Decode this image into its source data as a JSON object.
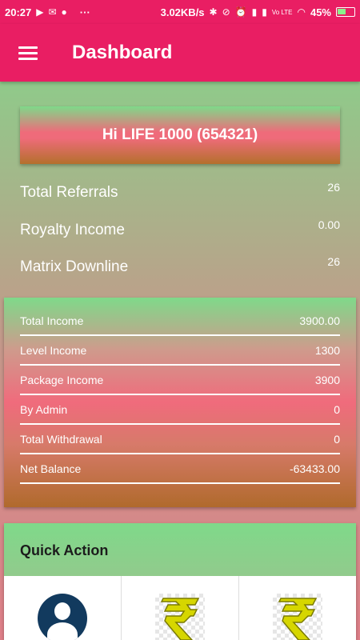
{
  "status_bar": {
    "time": "20:27",
    "dots": "···",
    "speed": "3.02KB/s",
    "battery": "45%",
    "network": "Vo LTE"
  },
  "app_bar": {
    "title": "Dashboard"
  },
  "hero": {
    "text": "Hi LIFE 1000  (654321)"
  },
  "stats": [
    {
      "label": "Total Referrals",
      "value": "26"
    },
    {
      "label": "Royalty Income",
      "value": "0.00"
    },
    {
      "label": "Matrix Downline",
      "value": "26"
    }
  ],
  "income": [
    {
      "label": "Total Income",
      "value": "3900.00"
    },
    {
      "label": "Level Income",
      "value": "1300"
    },
    {
      "label": "Package Income",
      "value": "3900"
    },
    {
      "label": "By Admin",
      "value": "0"
    },
    {
      "label": "Total Withdrawal",
      "value": "0"
    },
    {
      "label": "Net Balance",
      "value": "-63433.00"
    }
  ],
  "quick_action": {
    "title": "Quick Action"
  },
  "icons": {
    "profile": "user-avatar-icon",
    "rupee": "rupee-icon"
  },
  "colors": {
    "primary": "#e91e63",
    "avatar": "#123a5e"
  }
}
